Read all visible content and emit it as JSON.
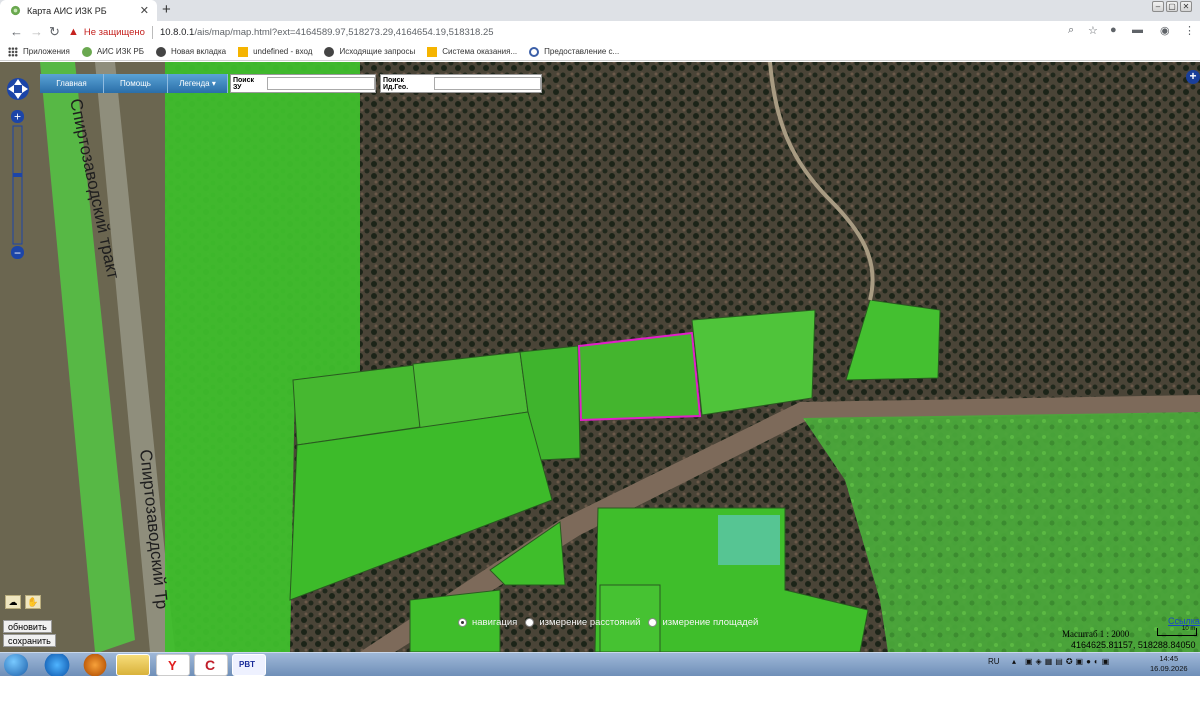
{
  "browser": {
    "tab_title": "Карта АИС ИЗК РБ",
    "new_tab": "+",
    "insecure_label": "Не защищено",
    "url_host": "10.8.0.1",
    "url_path": "/ais/map/map.html?ext=4164589.97,518273.29,4164654.19,518318.25"
  },
  "bookmarks": [
    {
      "label": "Приложения",
      "icon": "apps-icon"
    },
    {
      "label": "АИС ИЗК РБ",
      "icon": "leaf-icon"
    },
    {
      "label": "Новая вкладка",
      "icon": "globe-icon"
    },
    {
      "label": "undefined - вход",
      "icon": "folder-icon"
    },
    {
      "label": "Исходящие запросы",
      "icon": "globe-icon"
    },
    {
      "label": "Система оказания...",
      "icon": "folder-icon"
    },
    {
      "label": "Предоставление с...",
      "icon": "gear-globe-icon"
    }
  ],
  "map": {
    "menu": [
      "Главная",
      "Помощь",
      "Легенда"
    ],
    "search_zu_label": "Поиск ЗУ",
    "search_geo_label": "Поиск Ид.Гео.",
    "refresh_label": "обновить",
    "save_label": "сохранить",
    "mode_navigation": "навигация",
    "mode_distance": "измерение расстояний",
    "mode_area": "измерение площадей",
    "scale": "Масштаб 1 : 2000",
    "scale_bar": "10 m",
    "coords": "4164625.81157, 518288.84050",
    "link_label": "Ссылка",
    "road_label": "Спиртозаводский тракт",
    "road_label_2": "Спиртозаводский тракт",
    "road_label_3": "Спиртозаводский Тр",
    "colors": {
      "parcel_fill": "#3fcf2a",
      "selected_outline": "#e020c8",
      "menu_blue": "#3a82c0"
    }
  },
  "taskbar": {
    "lang": "RU",
    "time": "14:45",
    "date": "16.09.2026"
  }
}
